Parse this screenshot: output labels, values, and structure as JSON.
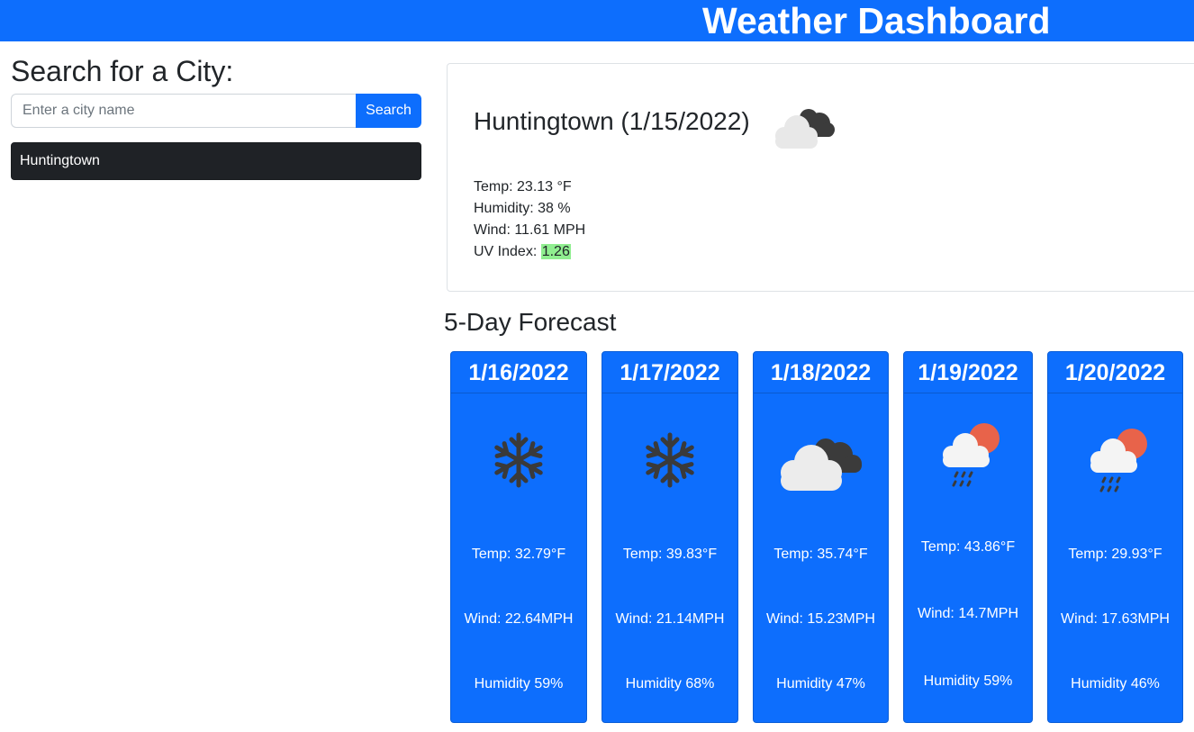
{
  "header": {
    "title": "Weather Dashboard"
  },
  "search": {
    "heading": "Search for a City:",
    "placeholder": "Enter a city name",
    "value": "",
    "button_label": "Search",
    "history": [
      "Huntingtown"
    ]
  },
  "current": {
    "title": "Huntingtown (1/15/2022)",
    "icon": "cloudy-icon",
    "temp_label": "Temp: 23.13 °F",
    "humidity_label": "Humidity: 38 %",
    "wind_label": "Wind: 11.61 MPH",
    "uv_label": "UV Index: ",
    "uv_value": "1.26",
    "uv_color": "#90ee90"
  },
  "forecast": {
    "heading": "5-Day Forecast",
    "days": [
      {
        "date": "1/16/2022",
        "icon": "snowflake-icon",
        "temp": "Temp: 32.79°F",
        "wind": "Wind: 22.64MPH",
        "humidity": "Humidity 59%"
      },
      {
        "date": "1/17/2022",
        "icon": "snowflake-icon",
        "temp": "Temp: 39.83°F",
        "wind": "Wind: 21.14MPH",
        "humidity": "Humidity 68%"
      },
      {
        "date": "1/18/2022",
        "icon": "cloudy-icon",
        "temp": "Temp: 35.74°F",
        "wind": "Wind: 15.23MPH",
        "humidity": "Humidity 47%"
      },
      {
        "date": "1/19/2022",
        "icon": "sun-rain-cloud-icon",
        "temp": "Temp: 43.86°F",
        "wind": "Wind: 14.7MPH",
        "humidity": "Humidity 59%"
      },
      {
        "date": "1/20/2022",
        "icon": "sun-rain-cloud-icon",
        "temp": "Temp: 29.93°F",
        "wind": "Wind: 17.63MPH",
        "humidity": "Humidity 46%"
      }
    ]
  },
  "colors": {
    "primary": "#0d6efd",
    "history_bg": "#1f2226",
    "uv_favorable": "#90ee90"
  }
}
